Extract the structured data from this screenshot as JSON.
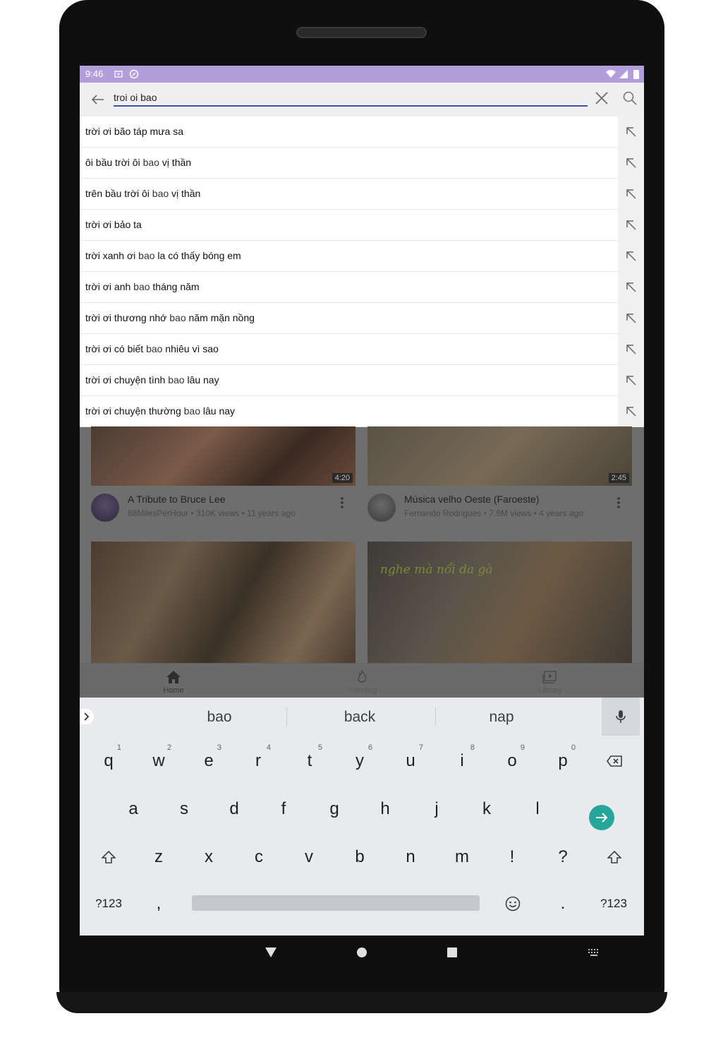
{
  "status_bar": {
    "time": "9:46"
  },
  "search": {
    "query": "troi oi bao"
  },
  "suggestions": [
    {
      "before": "trời ơi bão táp mưa sa",
      "match": "",
      "after": ""
    },
    {
      "before": "ôi bầu trời ôi ",
      "match": "bao",
      "after": " vị thần"
    },
    {
      "before": "trên bầu trời ôi ",
      "match": "bao",
      "after": " vị thần"
    },
    {
      "before": "trời ơi bảo ta",
      "match": "",
      "after": ""
    },
    {
      "before": "trời xanh ơi ",
      "match": "bao",
      "after": " la có thấy bóng em"
    },
    {
      "before": "trời ơi anh ",
      "match": "bao",
      "after": " tháng năm"
    },
    {
      "before": "trời ơi thương nhớ ",
      "match": "bao",
      "after": " năm mặn nồng"
    },
    {
      "before": "trời ơi có biết ",
      "match": "bao",
      "after": " nhiêu vì sao"
    },
    {
      "before": "trời ơi chuyện tình ",
      "match": "bao",
      "after": " lâu nay"
    },
    {
      "before": "trời ơi chuyện thường ",
      "match": "bao",
      "after": " lâu nay"
    }
  ],
  "videos": [
    {
      "title": "A Tribute to Bruce Lee",
      "channel": "88MilesPerHour",
      "views": "310K views",
      "age": "11 years ago",
      "duration": "4:20"
    },
    {
      "title": "Música velho Oeste (Faroeste)",
      "channel": "Fernando Rodrigues",
      "views": "7.9M views",
      "age": "4 years ago",
      "duration": "2:45"
    },
    {
      "overlay_text": ""
    },
    {
      "overlay_text": "nghe mà nổi da gà"
    }
  ],
  "bottom_nav": {
    "home": "Home",
    "trending": "Trending",
    "library": "Library"
  },
  "keyboard": {
    "suggestions": [
      "bao",
      "back",
      "nap"
    ],
    "row1": [
      {
        "k": "q",
        "n": "1"
      },
      {
        "k": "w",
        "n": "2"
      },
      {
        "k": "e",
        "n": "3"
      },
      {
        "k": "r",
        "n": "4"
      },
      {
        "k": "t",
        "n": "5"
      },
      {
        "k": "y",
        "n": "6"
      },
      {
        "k": "u",
        "n": "7"
      },
      {
        "k": "i",
        "n": "8"
      },
      {
        "k": "o",
        "n": "9"
      },
      {
        "k": "p",
        "n": "0"
      }
    ],
    "row2": [
      "a",
      "s",
      "d",
      "f",
      "g",
      "h",
      "j",
      "k",
      "l"
    ],
    "row3": [
      "z",
      "x",
      "c",
      "v",
      "b",
      "n",
      "m",
      "!",
      "?"
    ],
    "symbols_label": "?123",
    "comma": ",",
    "period": "."
  },
  "colors": {
    "status_bar": "#b39ddb",
    "search_underline": "#3f51b5",
    "enter_key": "#26a69a"
  }
}
